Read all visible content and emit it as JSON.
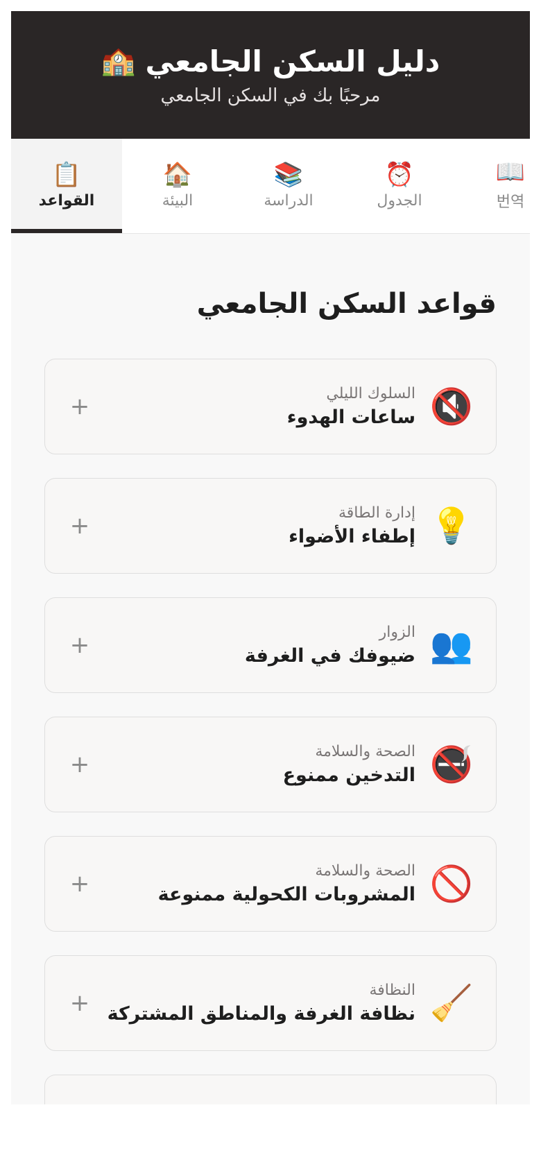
{
  "header": {
    "icon": "🏫",
    "title": "دليل السكن الجامعي",
    "subtitle": "مرحبًا بك في السكن الجامعي"
  },
  "tabs": [
    {
      "label": "القواعد",
      "icon": "📋",
      "active": true
    },
    {
      "label": "البيئة",
      "icon": "🏠",
      "active": false
    },
    {
      "label": "الدراسة",
      "icon": "📚",
      "active": false
    },
    {
      "label": "الجدول",
      "icon": "⏰",
      "active": false
    },
    {
      "label": "번역",
      "icon": "📖",
      "active": false
    }
  ],
  "section_title": "قواعد السكن الجامعي",
  "rules": [
    {
      "category": "السلوك الليلي",
      "title": "ساعات الهدوء",
      "icon": "🔇"
    },
    {
      "category": "إدارة الطاقة",
      "title": "إطفاء الأضواء",
      "icon": "💡"
    },
    {
      "category": "الزوار",
      "title": "ضيوفك في الغرفة",
      "icon": "👥"
    },
    {
      "category": "الصحة والسلامة",
      "title": "التدخين ممنوع",
      "icon": "🚭"
    },
    {
      "category": "الصحة والسلامة",
      "title": "المشروبات الكحولية ممنوعة",
      "icon": "🚫"
    },
    {
      "category": "النظافة",
      "title": "نظافة الغرفة والمناطق المشتركة",
      "icon": "🧹"
    }
  ],
  "toggle_symbol": "+"
}
